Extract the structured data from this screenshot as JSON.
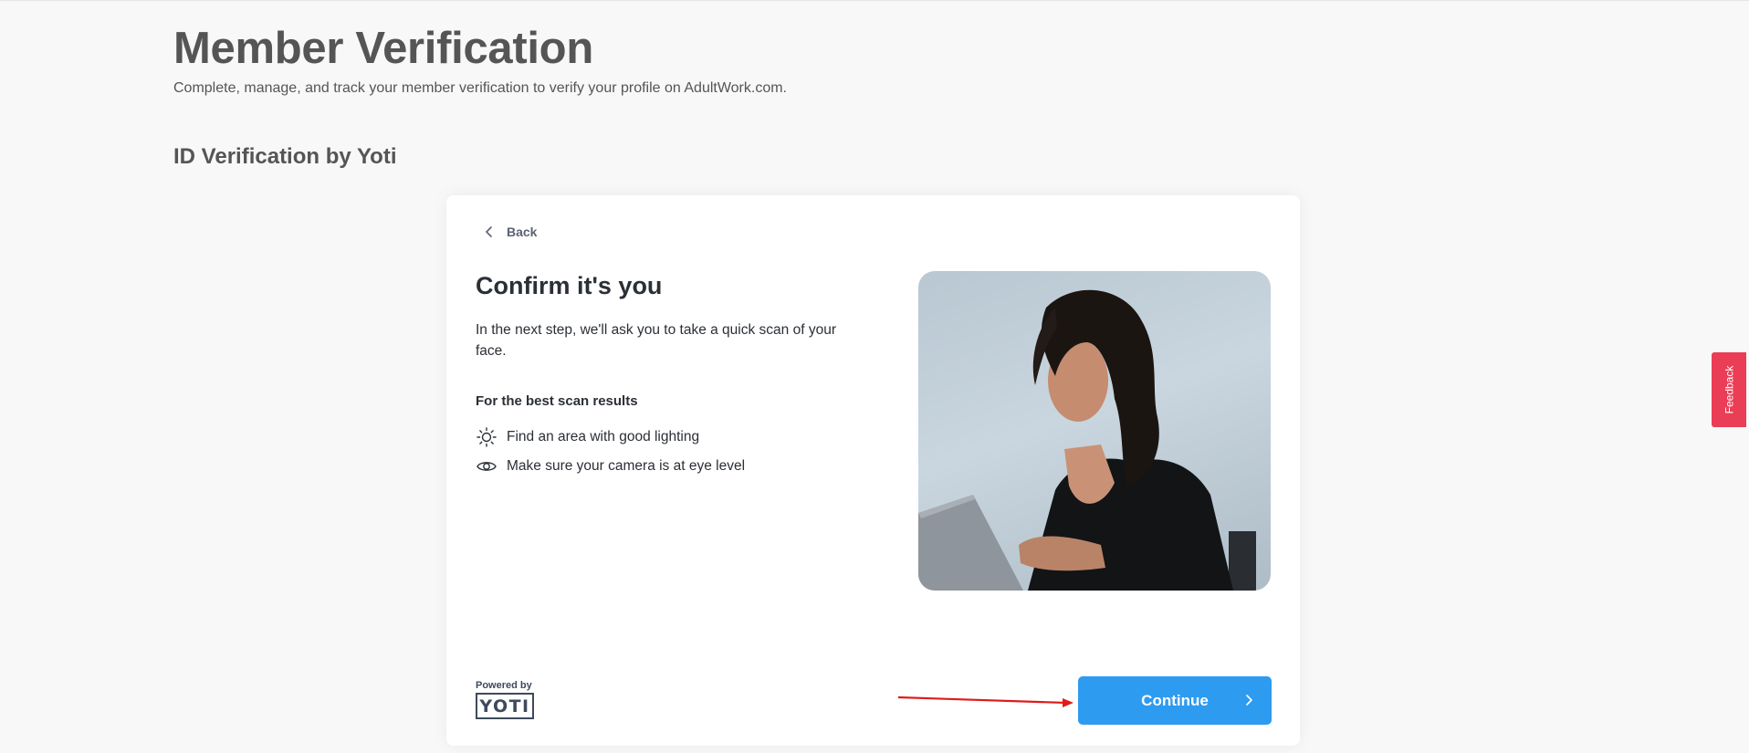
{
  "page": {
    "title": "Member Verification",
    "subtitle": "Complete, manage, and track your member verification to verify your profile on AdultWork.com.",
    "section_title": "ID Verification by Yoti"
  },
  "card": {
    "back_label": "Back",
    "heading": "Confirm it's you",
    "intro": "In the next step, we'll ask you to take a quick scan of your face.",
    "tips_heading": "For the best scan results",
    "tips": [
      {
        "icon": "sun-icon",
        "text": "Find an area with good lighting"
      },
      {
        "icon": "eye-icon",
        "text": "Make sure your camera is at eye level"
      }
    ],
    "photo_alt": "person-using-laptop-photo",
    "powered_by": "Powered by",
    "logo_text": "YOTI",
    "continue_label": "Continue"
  },
  "feedback": {
    "label": "Feedback"
  },
  "colors": {
    "primary_button": "#2d9bf0",
    "feedback_tab": "#ea3d56",
    "annotation_arrow": "#e01b1b",
    "background": "#f8f8f8"
  }
}
